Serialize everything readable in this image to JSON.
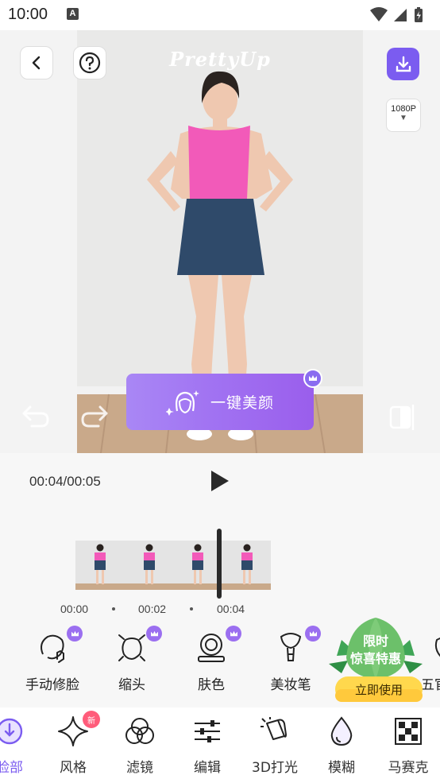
{
  "status_bar": {
    "time": "10:00",
    "indicator": "A"
  },
  "preview": {
    "watermark": "PrettyUp",
    "resolution": "1080P",
    "beauty_button_label": "一键美颜"
  },
  "player": {
    "time_display": "00:04/00:05",
    "ticks": [
      "00:00",
      "00:02",
      "00:04"
    ]
  },
  "tools": [
    {
      "label": "手动修脸",
      "icon": "manual-face-icon",
      "premium": true
    },
    {
      "label": "缩头",
      "icon": "shrink-head-icon",
      "premium": true
    },
    {
      "label": "肤色",
      "icon": "skin-tone-icon",
      "premium": true
    },
    {
      "label": "美妆笔",
      "icon": "makeup-brush-icon",
      "premium": true
    },
    {
      "label": "五官",
      "icon": "features-icon",
      "premium": false
    }
  ],
  "promo": {
    "title_line1": "限时",
    "title_line2": "惊喜特惠",
    "cta": "立即使用"
  },
  "tabs": [
    {
      "label": "脸部",
      "icon": "face-icon",
      "active": true
    },
    {
      "label": "风格",
      "icon": "sparkle-icon",
      "badge": "新"
    },
    {
      "label": "滤镜",
      "icon": "filter-icon"
    },
    {
      "label": "编辑",
      "icon": "sliders-icon"
    },
    {
      "label": "3D打光",
      "icon": "spotlight-icon"
    },
    {
      "label": "模糊",
      "icon": "blur-drop-icon"
    },
    {
      "label": "马赛克",
      "icon": "mosaic-icon"
    }
  ],
  "colors": {
    "accent": "#7b5cf0",
    "beauty_gradient_start": "#a987f5",
    "beauty_gradient_end": "#9a5eec",
    "promo_gold": "#ffd84d"
  }
}
